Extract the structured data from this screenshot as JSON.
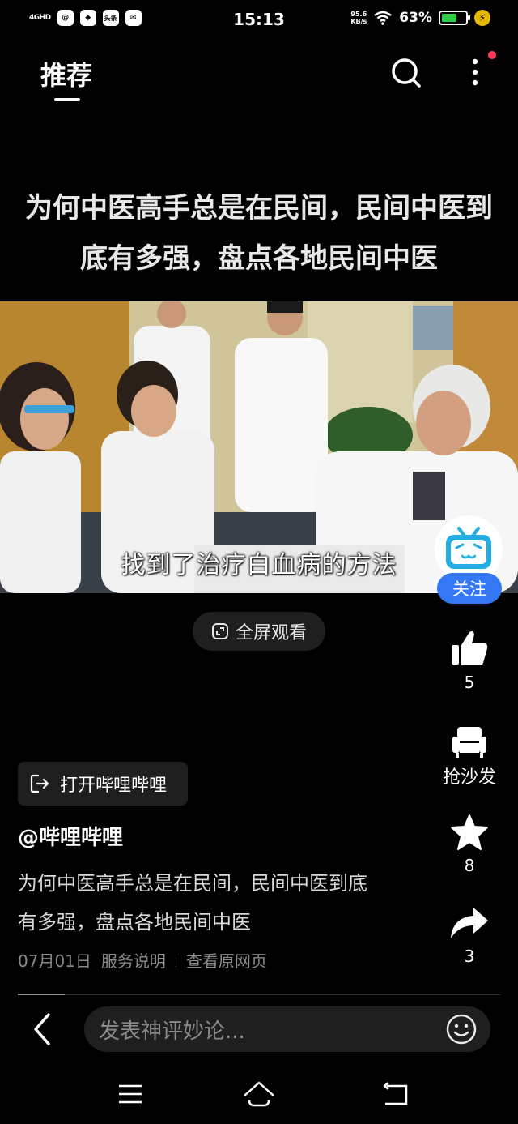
{
  "status_bar": {
    "network": "4GHD",
    "app_badge_1": "@",
    "app_badge_2": "◆",
    "app_badge_3": "头条",
    "time": "15:13",
    "speed_value": "95.6",
    "speed_unit": "KB/s",
    "battery_text": "63%",
    "battery_level": 0.63
  },
  "header": {
    "tab_label": "推荐"
  },
  "video": {
    "title": "为何中医高手总是在民间，民间中医到底有多强，盘点各地民间中医",
    "subtitle": "找到了治疗白血病的方法",
    "fullscreen_label": "全屏观看"
  },
  "rail": {
    "follow_label": "关注",
    "like_count": "5",
    "sofa_label": "抢沙发",
    "favorite_count": "8",
    "share_count": "3"
  },
  "post": {
    "open_app_label": "打开哔哩哔哩",
    "author": "@哔哩哔哩",
    "description": "为何中医高手总是在民间，民间中医到底有多强，盘点各地民间中医",
    "date": "07月01日",
    "service_link": "服务说明",
    "original_link": "查看原网页"
  },
  "comment_bar": {
    "placeholder": "发表神评妙论..."
  },
  "colors": {
    "accent_blue": "#3478f6",
    "notification_red": "#ff3b5c",
    "battery_green": "#2ecc40"
  }
}
